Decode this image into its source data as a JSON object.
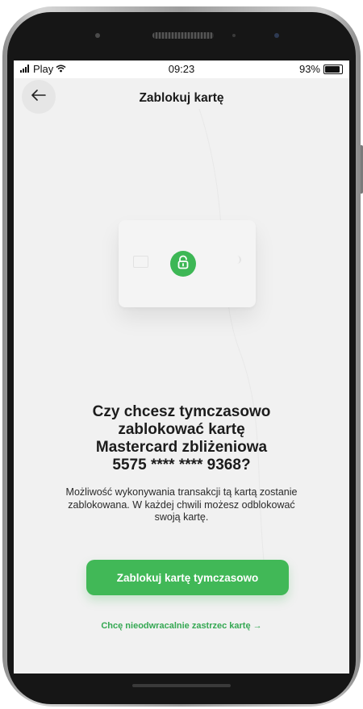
{
  "statusbar": {
    "carrier": "Play",
    "time": "09:23",
    "battery": "93%",
    "battery_level": 0.93
  },
  "header": {
    "title": "Zablokuj kartę"
  },
  "card": {
    "icon": "lock-icon",
    "accent_color": "#3db755"
  },
  "question": {
    "line1": "Czy chcesz tymczasowo",
    "line2": "zablokować kartę",
    "line3": "Mastercard zbliżeniowa",
    "line4": "5575 **** **** 9368?"
  },
  "description": {
    "line1": "Możliwość wykonywania transakcji tą kartą zostanie",
    "line2": "zablokowana. W każdej chwili możesz odblokować",
    "line3": "swoją kartę."
  },
  "actions": {
    "primary_label": "Zablokuj kartę tymczasowo",
    "secondary_link": "Chcę nieodwracalnie zastrzec kartę →"
  }
}
